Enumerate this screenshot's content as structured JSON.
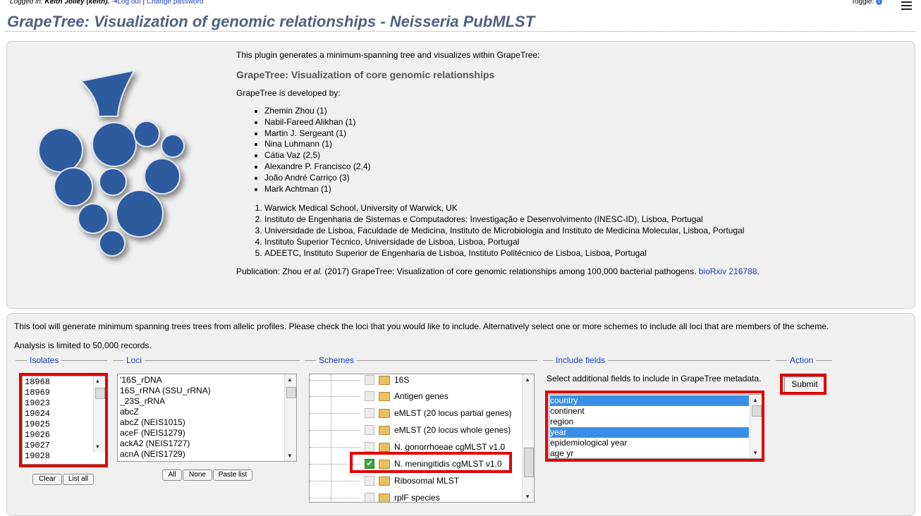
{
  "topbar": {
    "logged_in_prefix": "Logged in: ",
    "user": "Keith Jolley (keith).",
    "logout": "Log out",
    "separator": " | ",
    "change_password": "Change password",
    "toggle": "Toggle: "
  },
  "page_title": "GrapeTree: Visualization of genomic relationships - Neisseria PubMLST",
  "intro": {
    "line1": "This plugin generates a minimum-spanning tree and visualizes within GrapeTree:",
    "heading": "GrapeTree: Visualization of core genomic relationships",
    "developed_by": "GrapeTree is developed by:",
    "authors": [
      "Zhemin Zhou (1)",
      "Nabil-Fareed Alikhan (1)",
      "Martin J. Sergeant (1)",
      "Nina Luhmann (1)",
      "Cátia Vaz (2,5)",
      "Alexandre P. Francisco (2,4)",
      "João André Carriço (3)",
      "Mark Achtman (1)"
    ],
    "affiliations": [
      "Warwick Medical School, University of Warwick, UK",
      "Instituto de Engenharia de Sistemas e Computadores: Investigação e Desenvolvimento (INESC-ID), Lisboa, Portugal",
      "Universidade de Lisboa, Faculdade de Medicina, Instituto de Microbiologia and Instituto de Medicina Molecular, Lisboa, Portugal",
      "Instituto Superior Técnico, Universidade de Lisboa, Lisboa, Portugal",
      "ADEETC, Instituto Superior de Engenharia de Lisboa, Instituto Politécnico de Lisboa, Lisboa, Portugal"
    ],
    "publication_prefix": "Publication: Zhou ",
    "publication_etal": "et al.",
    "publication_rest": " (2017) GrapeTree: Visualization of core genomic relationships among 100,000 bacterial pathogens. ",
    "publication_link": "bioRxiv 216788",
    "publication_end": "."
  },
  "form": {
    "description": "This tool will generate minimum spanning trees trees from allelic profiles. Please check the loci that you would like to include. Alternatively select one or more schemes to include all loci that are members of the scheme.",
    "limit": "Analysis is limited to 50,000 records.",
    "isolates": {
      "legend": "Isolates",
      "items": [
        "18968",
        "18969",
        "19023",
        "19024",
        "19025",
        "19026",
        "19027",
        "19028"
      ],
      "clear": "Clear",
      "list_all": "List all"
    },
    "loci": {
      "legend": "Loci",
      "items": [
        "'16S_rDNA",
        "16S_rRNA (SSU_rRNA)",
        "_23S_rRNA",
        "abcZ",
        "abcZ (NEIS1015)",
        "aceF (NEIS1279)",
        "ackA2 (NEIS1727)",
        "acnA (NEIS1729)"
      ],
      "all": "All",
      "none": "None",
      "paste": "Paste list"
    },
    "schemes": {
      "legend": "Schemes",
      "items": [
        {
          "label": "16S",
          "checked": false
        },
        {
          "label": "Antigen genes",
          "checked": false
        },
        {
          "label": "eMLST (20 locus partial genes)",
          "checked": false
        },
        {
          "label": "eMLST (20 locus whole genes)",
          "checked": false
        },
        {
          "label": "N. gonorrhoeae cgMLST v1.0",
          "checked": false
        },
        {
          "label": "N. meningitidis cgMLST v1.0",
          "checked": true
        },
        {
          "label": "Ribosomal MLST",
          "checked": false
        },
        {
          "label": "rplF species",
          "checked": false
        }
      ]
    },
    "fields": {
      "legend": "Include fields",
      "hint": "Select additional fields to include in GrapeTree metadata.",
      "items": [
        {
          "label": "country",
          "selected": true
        },
        {
          "label": "continent",
          "selected": false
        },
        {
          "label": "region",
          "selected": false
        },
        {
          "label": "year",
          "selected": true
        },
        {
          "label": "epidemiological year",
          "selected": false
        },
        {
          "label": "age yr",
          "selected": false
        }
      ]
    },
    "action": {
      "legend": "Action",
      "submit": "Submit"
    }
  },
  "colors": {
    "title": "#506080",
    "link": "#1a3fc0",
    "highlight_box": "#e00000",
    "selection": "#3a8ee6",
    "grape": "#2f5a9e"
  }
}
